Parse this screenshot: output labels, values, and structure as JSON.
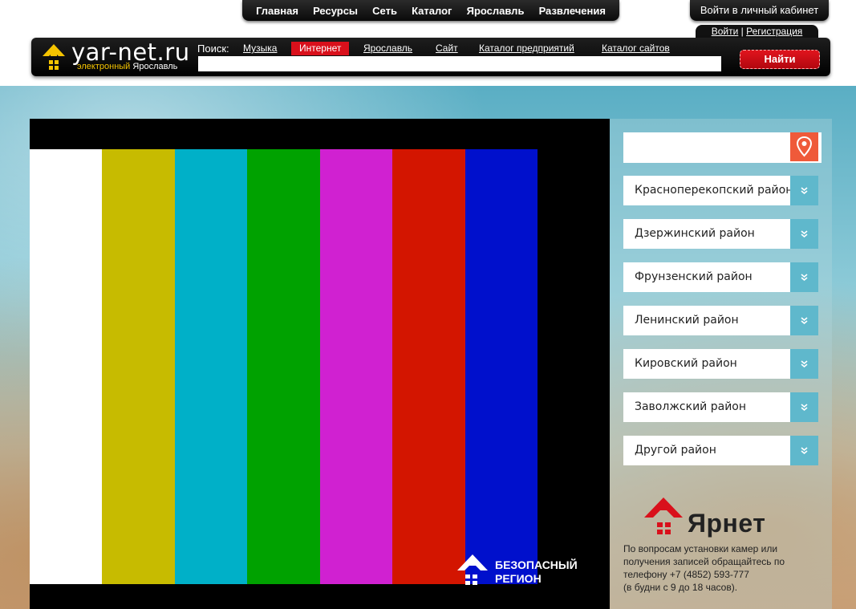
{
  "topnav": {
    "items": [
      "Главная",
      "Ресурсы",
      "Сеть",
      "Каталог",
      "Ярославль",
      "Развлечения"
    ],
    "cabinet": "Войти в личный кабинет"
  },
  "auth": {
    "login": "Войти",
    "separator": "|",
    "register": "Регистрация"
  },
  "logo": {
    "name": "yar-net.ru",
    "sub_highlight": "электронный",
    "sub_city": "Ярославль"
  },
  "search": {
    "label": "Поиск:",
    "links": [
      "Музыка",
      "Интернет",
      "Ярославль",
      "Сайт",
      "Каталог предприятий",
      "Каталог сайтов"
    ],
    "active_link": "Интернет",
    "button": "Найти",
    "value": "",
    "placeholder": ""
  },
  "video": {
    "bar_colors": [
      "#ffffff",
      "#c7bb00",
      "#00b0c8",
      "#00a200",
      "#d021d1",
      "#d31500",
      "#0010cc"
    ],
    "watermark_line1": "БЕЗОПАСНЫЙ",
    "watermark_line2": "РЕГИОН"
  },
  "sidebar": {
    "search_value": "",
    "search_placeholder": "",
    "districts": [
      "Красноперекопский район",
      "Дзержинский район",
      "Фрунзенский район",
      "Ленинский район",
      "Кировский район",
      "Заволжский район",
      "Другой район"
    ],
    "brand": "Ярнет",
    "contact_line1": "По вопросам установки камер или",
    "contact_line2": "получения записей обращайтесь по",
    "contact_line3": "телефону +7 (4852) 593-777",
    "contact_line4": "(в будни с 9 до 18 часов)."
  },
  "colors": {
    "accent_red": "#d9101b",
    "pin_orange": "#ef5a3a",
    "chevron_teal": "#5fb8cc"
  }
}
